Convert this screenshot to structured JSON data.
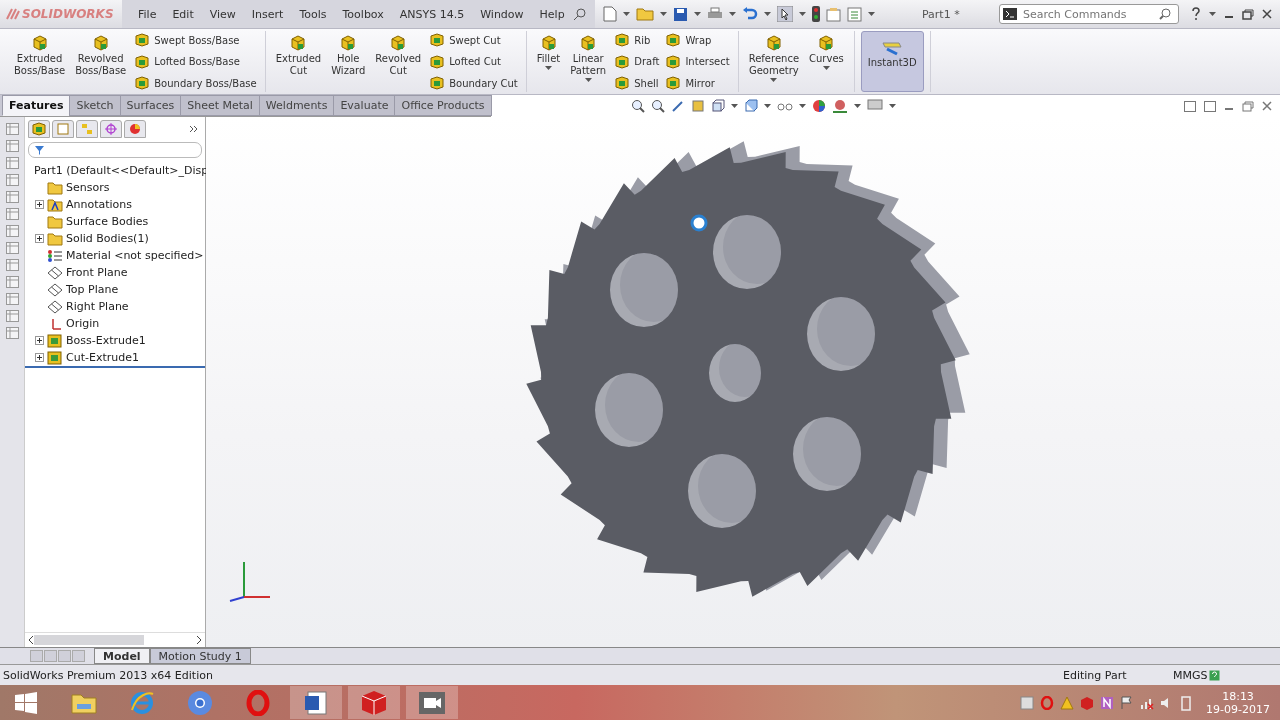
{
  "app": {
    "logo": "SOLIDWORKS",
    "menu": [
      "File",
      "Edit",
      "View",
      "Insert",
      "Tools",
      "Toolbox",
      "ANSYS 14.5",
      "Window",
      "Help"
    ],
    "title": "Part1 *",
    "search": {
      "placeholder": "Search Commands"
    }
  },
  "ribbon": {
    "groups": [
      {
        "items": [
          {
            "kind": "large",
            "label": "Extruded\nBoss/Base",
            "dropdown": false
          },
          {
            "kind": "large",
            "label": "Revolved\nBoss/Base",
            "dropdown": false
          },
          {
            "kind": "stack",
            "labels": [
              "Swept Boss/Base",
              "Lofted Boss/Base",
              "Boundary Boss/Base"
            ]
          }
        ]
      },
      {
        "items": [
          {
            "kind": "large",
            "label": "Extruded\nCut",
            "dropdown": false
          },
          {
            "kind": "large",
            "label": "Hole\nWizard",
            "dropdown": false
          },
          {
            "kind": "large",
            "label": "Revolved\nCut",
            "dropdown": false
          },
          {
            "kind": "stack",
            "labels": [
              "Swept Cut",
              "Lofted Cut",
              "Boundary Cut"
            ]
          }
        ]
      },
      {
        "items": [
          {
            "kind": "large",
            "label": "Fillet",
            "dropdown": true
          },
          {
            "kind": "large",
            "label": "Linear\nPattern",
            "dropdown": true
          },
          {
            "kind": "stack",
            "labels": [
              "Rib",
              "Draft",
              "Shell"
            ]
          },
          {
            "kind": "stack",
            "labels": [
              "Wrap",
              "Intersect",
              "Mirror"
            ]
          }
        ]
      },
      {
        "items": [
          {
            "kind": "large",
            "label": "Reference\nGeometry",
            "dropdown": true
          },
          {
            "kind": "large",
            "label": "Curves",
            "dropdown": true
          }
        ]
      },
      {
        "items": [
          {
            "kind": "toggle",
            "label": "Instant3D",
            "on": true
          }
        ]
      }
    ]
  },
  "tabs": [
    {
      "label": "Features",
      "selected": true
    },
    {
      "label": "Sketch",
      "selected": false
    },
    {
      "label": "Surfaces",
      "selected": false
    },
    {
      "label": "Sheet Metal",
      "selected": false
    },
    {
      "label": "Weldments",
      "selected": false
    },
    {
      "label": "Evaluate",
      "selected": false
    },
    {
      "label": "Office Products",
      "selected": false
    }
  ],
  "tree": {
    "root": "Part1  (Default<<Default>_Disp",
    "children": [
      {
        "label": "Sensors",
        "kind": "folder",
        "collapsed": false
      },
      {
        "label": "Annotations",
        "kind": "annotation",
        "collapsed": true
      },
      {
        "label": "Surface Bodies",
        "kind": "folder",
        "collapsed": false
      },
      {
        "label": "Solid Bodies(1)",
        "kind": "folder",
        "collapsed": true
      },
      {
        "label": "Material <not specified>",
        "kind": "material",
        "collapsed": false
      },
      {
        "label": "Front Plane",
        "kind": "plane",
        "collapsed": false
      },
      {
        "label": "Top Plane",
        "kind": "plane",
        "collapsed": false
      },
      {
        "label": "Right Plane",
        "kind": "plane",
        "collapsed": false
      },
      {
        "label": "Origin",
        "kind": "origin",
        "collapsed": false
      },
      {
        "label": "Boss-Extrude1",
        "kind": "feature",
        "collapsed": true
      },
      {
        "label": "Cut-Extrude1",
        "kind": "feature",
        "collapsed": true
      }
    ]
  },
  "bottom_tabs": [
    {
      "label": "Model",
      "selected": true
    },
    {
      "label": "Motion Study 1",
      "selected": false
    }
  ],
  "status_bar": {
    "edition": "SolidWorks Premium 2013 x64 Edition",
    "mode": "Editing Part",
    "units": "MMGS"
  },
  "taskbar": {
    "time": "18:13",
    "date": "19-09-2017"
  }
}
